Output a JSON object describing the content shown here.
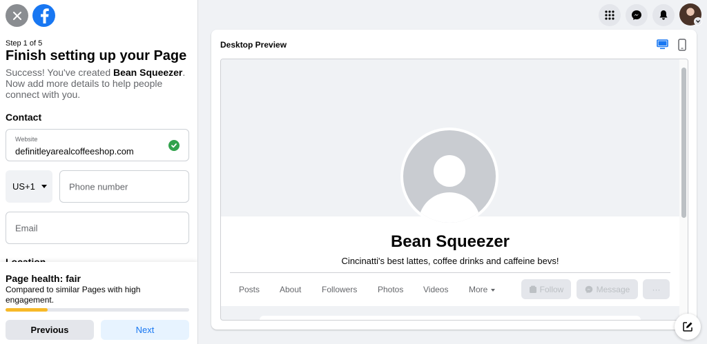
{
  "setup": {
    "step": "Step 1 of 5",
    "title": "Finish setting up your Page",
    "desc_prefix": "Success! You've created ",
    "page_name": "Bean Squeezer",
    "desc_suffix": ". Now add more details to help people connect with you.",
    "contact_heading": "Contact",
    "website_label": "Website",
    "website_value": "definitleyarealcoffeeshop.com",
    "country_code": "US+1",
    "phone_placeholder": "Phone number",
    "email_placeholder": "Email",
    "location_heading": "Location"
  },
  "health": {
    "title": "Page health: fair",
    "desc": "Compared to similar Pages with high engagement.",
    "progress": 0.23
  },
  "nav_buttons": {
    "previous": "Previous",
    "next": "Next"
  },
  "preview": {
    "heading": "Desktop Preview",
    "page_name": "Bean Squeezer",
    "tagline": "Cincinatti's best lattes, coffee drinks and caffeine bevs!",
    "tabs": [
      "Posts",
      "About",
      "Followers",
      "Photos",
      "Videos",
      "More"
    ],
    "follow_label": "Follow",
    "message_label": "Message",
    "more_actions_label": "···"
  },
  "colors": {
    "accent": "#1877f2",
    "success": "#31a24c",
    "health_bar": "#f7b928"
  },
  "icons": {
    "top_bar": [
      "apps-grid-icon",
      "messenger-icon",
      "bell-icon"
    ],
    "device": [
      "desktop-icon",
      "mobile-icon"
    ]
  }
}
